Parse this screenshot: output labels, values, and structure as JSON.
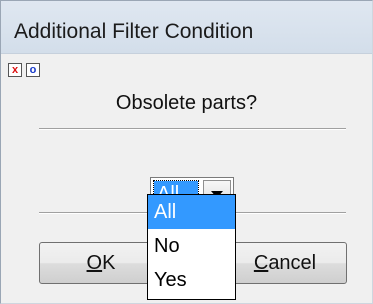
{
  "window": {
    "title": "Additional Filter Condition"
  },
  "toolbar": {
    "close_icon_glyph": "x",
    "option_icon_glyph": "o"
  },
  "main": {
    "question": "Obsolete parts?"
  },
  "combo": {
    "selected_value": "All",
    "options": [
      "All",
      "No",
      "Yes"
    ],
    "highlighted_index": 0,
    "dropdown_open": true
  },
  "buttons": {
    "ok_mnemonic": "O",
    "ok_rest": "K",
    "cancel_mnemonic": "C",
    "cancel_rest": "ancel"
  },
  "colors": {
    "selection": "#3399ff",
    "client_bg": "#f0f0f0",
    "title_bg": "#d6e0ec"
  }
}
